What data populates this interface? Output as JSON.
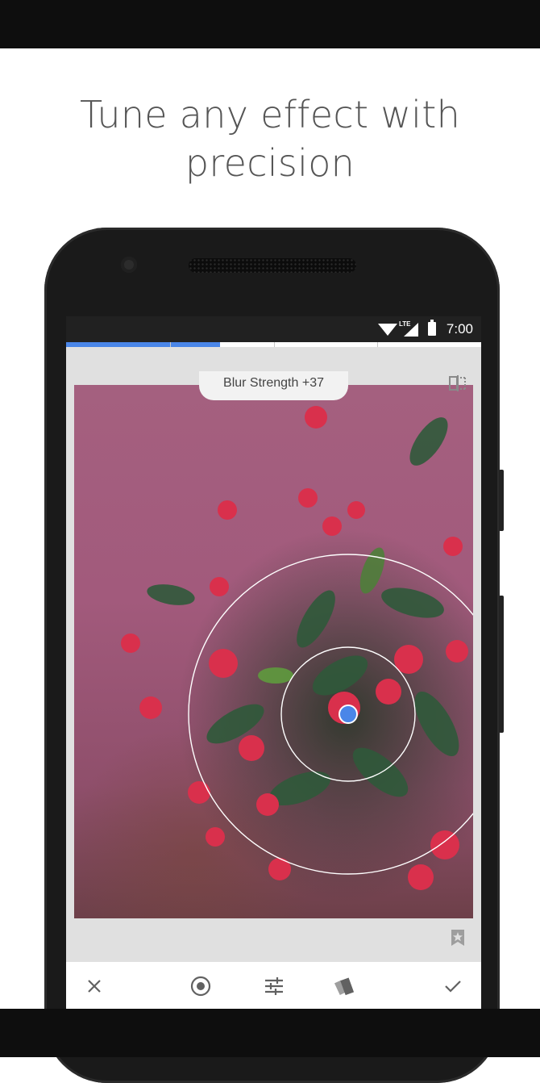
{
  "headline": {
    "line1": "Tune any effect with",
    "line2": "precision"
  },
  "statusbar": {
    "time": "7:00",
    "network": "LTE",
    "icons": [
      "wifi-icon",
      "lte-signal-icon",
      "battery-icon"
    ]
  },
  "editor": {
    "blur_label": "Blur Strength +37",
    "progress_percent": 37,
    "compare_icon": "compare-icon",
    "bookmark_icon": "bookmark-icon"
  },
  "toolbar": {
    "items": [
      {
        "name": "cancel",
        "icon": "close-icon"
      },
      {
        "name": "focus-point",
        "icon": "target-icon"
      },
      {
        "name": "adjust",
        "icon": "sliders-icon"
      },
      {
        "name": "styles",
        "icon": "styles-icon"
      },
      {
        "name": "apply",
        "icon": "check-icon"
      }
    ]
  },
  "colors": {
    "accent": "#4a86e8",
    "photo_tint": "#a4607f",
    "status_bar": "#212121"
  }
}
